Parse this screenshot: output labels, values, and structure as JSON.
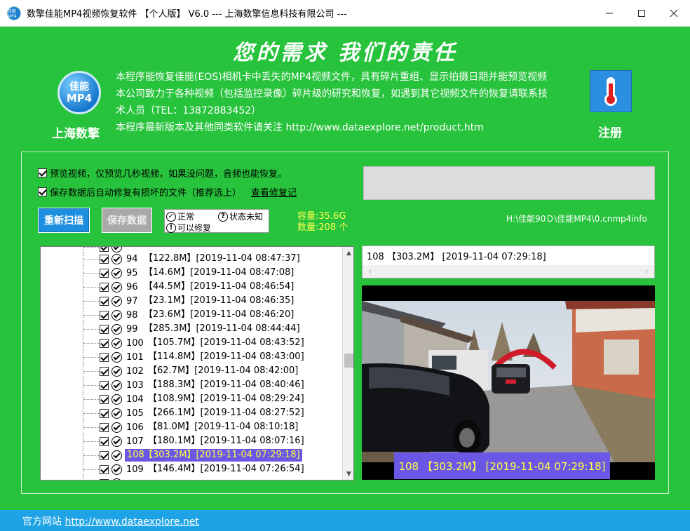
{
  "window": {
    "title": "数擎佳能MP4视频恢复软件  【个人版】  V6.0  --- 上海数擎信息科技有限公司 ---",
    "icon_text": "佳能MP4",
    "controls": [
      "minimize-icon",
      "maximize-icon",
      "close-icon"
    ]
  },
  "header": {
    "slogan": "您的需求    我们的责任",
    "logo_line1": "佳能",
    "logo_line2": "MP4",
    "company": "上海数擎",
    "description": [
      "本程序能恢复佳能(EOS)相机卡中丢失的MP4视频文件，具有碎片重组、显示拍摄日期并能预览视频",
      "本公司致力于各种视频（包括监控录像）碎片级的研究和恢复，如遇到其它视频文件的恢复请联系技",
      "术人员（TEL：13872883452）",
      "本程序最新版本及其他同类软件请关注 http://www.dataexplore.net/product.htm"
    ],
    "register_label": "注册"
  },
  "options": {
    "preview_only": {
      "label": "预览视频，仅预览几秒视频，如果没问题，音频也能恢复。",
      "checked": true
    },
    "auto_repair": {
      "label": "保存数据后自动修复有损坏的文件（推荐选上）",
      "checked": true
    },
    "view_repair_log": "查看修复记"
  },
  "toolbar": {
    "rescan": "重新扫描",
    "save": "保存数据"
  },
  "legend": {
    "normal": "正常",
    "unknown": "状态未知",
    "repairable": "可以修复"
  },
  "stats": {
    "capacity": "容量:35.6G",
    "count": "数量:208 个"
  },
  "file_path": "H:\\佳能90Ｄ\\佳能MP4\\0.cnmp4info",
  "file_list": {
    "rows": [
      {
        "id": "94",
        "size": "【122.8M】",
        "date": "[2019-11-04 08:47:37]",
        "selected": false
      },
      {
        "id": "95",
        "size": "【14.6M】",
        "date": "[2019-11-04 08:47:08]",
        "selected": false
      },
      {
        "id": "96",
        "size": "【44.5M】",
        "date": "[2019-11-04 08:46:54]",
        "selected": false
      },
      {
        "id": "97",
        "size": "【23.1M】",
        "date": "[2019-11-04 08:46:35]",
        "selected": false
      },
      {
        "id": "98",
        "size": "【23.6M】",
        "date": "[2019-11-04 08:46:20]",
        "selected": false
      },
      {
        "id": "99",
        "size": "【285.3M】",
        "date": "[2019-11-04 08:44:44]",
        "selected": false
      },
      {
        "id": "100",
        "size": "【105.7M】",
        "date": "[2019-11-04 08:43:52]",
        "selected": false
      },
      {
        "id": "101",
        "size": "【114.8M】",
        "date": "[2019-11-04 08:43:00]",
        "selected": false
      },
      {
        "id": "102",
        "size": "【62.7M】",
        "date": "[2019-11-04 08:42:00]",
        "selected": false
      },
      {
        "id": "103",
        "size": "【188.3M】",
        "date": "[2019-11-04 08:40:46]",
        "selected": false
      },
      {
        "id": "104",
        "size": "【108.9M】",
        "date": "[2019-11-04 08:29:24]",
        "selected": false
      },
      {
        "id": "105",
        "size": "【266.1M】",
        "date": "[2019-11-04 08:27:52]",
        "selected": false
      },
      {
        "id": "106",
        "size": "【81.0M】",
        "date": "[2019-11-04 08:10:18]",
        "selected": false
      },
      {
        "id": "107",
        "size": "【180.1M】",
        "date": "[2019-11-04 08:07:16]",
        "selected": false
      },
      {
        "id": "108",
        "size": "【303.2M】",
        "date": "[2019-11-04 07:29:18]",
        "selected": true
      },
      {
        "id": "109",
        "size": "【146.4M】",
        "date": "[2019-11-04 07:26:54]",
        "selected": false
      }
    ]
  },
  "info": {
    "text": "108  【303.2M】 [2019-11-04 07:29:18]"
  },
  "video": {
    "caption": "108  【303.2M】 [2019-11-04 07:29:18]"
  },
  "statusbar": {
    "label": "官方网站",
    "url": "http://www.dataexplore.net"
  }
}
